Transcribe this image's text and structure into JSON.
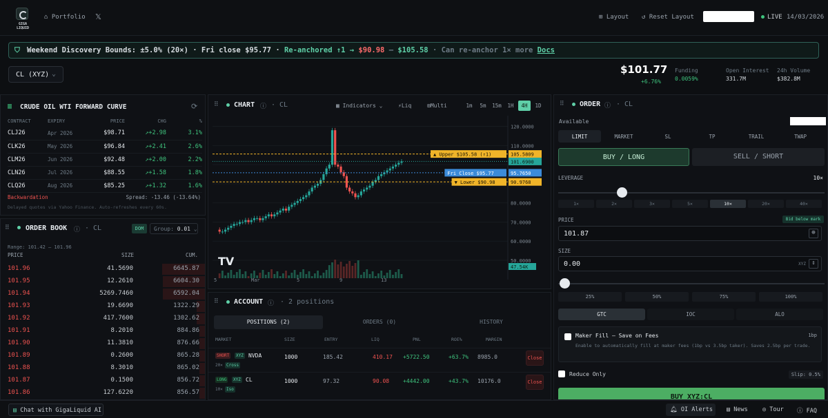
{
  "topbar": {
    "logo_text": "GIGA",
    "logo_sub": "LIQUID",
    "portfolio": "Portfolio",
    "x_icon": "x-icon",
    "layout": "Layout",
    "reset_layout": "Reset Layout",
    "live": "LIVE",
    "date": "14/03/2026"
  },
  "banner": {
    "part1": "Weekend Discovery Bounds: ±5.0% (20×) · Fri close $95.77 · ",
    "part2": "Re-anchored ↑1 → ",
    "low": "$90.98",
    "dash": " – ",
    "high": "$105.58",
    "part3": " · Can re-anchor 1× more ",
    "docs": "Docs"
  },
  "market": {
    "symbol": "CL (XYZ)",
    "price": "$101.77",
    "change": "+6.76%",
    "funding_label": "Funding",
    "funding": "0.0059%",
    "oi_label": "Open Interest",
    "oi": "331.7M",
    "vol_label": "24h Volume",
    "vol": "$382.8M"
  },
  "curve": {
    "title": "CRUDE OIL WTI FORWARD CURVE",
    "headers": [
      "CONTRACT",
      "EXPIRY",
      "PRICE",
      "CHG",
      "%"
    ],
    "rows": [
      [
        "CLJ26",
        "Apr 2026",
        "$98.71",
        "↗+2.98",
        "3.1%"
      ],
      [
        "CLK26",
        "May 2026",
        "$96.84",
        "↗+2.41",
        "2.6%"
      ],
      [
        "CLM26",
        "Jun 2026",
        "$92.48",
        "↗+2.00",
        "2.2%"
      ],
      [
        "CLN26",
        "Jul 2026",
        "$88.55",
        "↗+1.58",
        "1.8%"
      ],
      [
        "CLQ26",
        "Aug 2026",
        "$85.25",
        "↗+1.32",
        "1.6%"
      ]
    ],
    "structure": "Backwardation",
    "spread": "Spread: -13.46 (-13.64%)",
    "note": "Delayed quotes via Yahoo Finance. Auto-refreshes every 60s."
  },
  "orderbook": {
    "title": "ORDER BOOK",
    "sym": "· CL",
    "dom": "DOM",
    "group_label": "Group:",
    "group": "0.01",
    "range": "Range: 101.42 – 101.96",
    "headers": [
      "PRICE",
      "SIZE",
      "CUM."
    ],
    "rows": [
      [
        "101.96",
        "41.5690",
        "6645.87"
      ],
      [
        "101.95",
        "12.2610",
        "6604.30"
      ],
      [
        "101.94",
        "5269.7460",
        "6592.04"
      ],
      [
        "101.93",
        "19.6690",
        "1322.29"
      ],
      [
        "101.92",
        "417.7600",
        "1302.62"
      ],
      [
        "101.91",
        "8.2010",
        "884.86"
      ],
      [
        "101.90",
        "11.3810",
        "876.66"
      ],
      [
        "101.89",
        "0.2600",
        "865.28"
      ],
      [
        "101.88",
        "8.3010",
        "865.02"
      ],
      [
        "101.87",
        "0.1500",
        "856.72"
      ],
      [
        "101.86",
        "127.6220",
        "856.57"
      ],
      [
        "101.85",
        "19.1150",
        "728.95"
      ]
    ],
    "depth": [
      1.0,
      0.99,
      0.99,
      0.2,
      0.2,
      0.13,
      0.13,
      0.13,
      0.13,
      0.13,
      0.13,
      0.11
    ]
  },
  "chart": {
    "title": "CHART",
    "sym": "· CL",
    "indicators": "Indicators",
    "liq": "Liq",
    "multi": "Multi",
    "timeframes": [
      "1m",
      "5m",
      "15m",
      "1H",
      "4H",
      "1D"
    ],
    "active_tf": "4H",
    "upper_label": "▲ Upper $105.58 (↑1)",
    "upper_val": "105.5809",
    "last_val": "101.6900",
    "fri_label": "Fri Close $95.77",
    "fri_val": "95.7650",
    "lower_label": "▼ Lower $90.98",
    "lower_val": "90.9768",
    "vol_val": "47.54K",
    "watermark": "TV",
    "colors": {
      "up": "#26a69a",
      "down": "#ef5350",
      "upper": "#f0b429",
      "fri": "#3c8bd9"
    }
  },
  "chart_data": {
    "type": "line",
    "x_ticks": [
      "5",
      "Mar",
      "5",
      "9",
      "13"
    ],
    "y_ticks": [
      "120.0000",
      "110.0000",
      "80.0000",
      "70.0000",
      "60.0000",
      "50.0000"
    ],
    "ylim": [
      50,
      122
    ],
    "series": [
      {
        "values": [
          66,
          65,
          65,
          66,
          67,
          68,
          69,
          69,
          70,
          70,
          71,
          70,
          71,
          72,
          72,
          71,
          72,
          73,
          74,
          73,
          74,
          75,
          76,
          77,
          76,
          78,
          79,
          80,
          81,
          82,
          83,
          84,
          86,
          88,
          89,
          90,
          92,
          95,
          98,
          100,
          118,
          100,
          99,
          96,
          94,
          88,
          86,
          85,
          83,
          84,
          86,
          87,
          88,
          89,
          91,
          92,
          94,
          95,
          96,
          97,
          98,
          99,
          100,
          101,
          101.7
        ]
      }
    ]
  },
  "account": {
    "title": "ACCOUNT",
    "positions_count": "· 2 positions",
    "tabs": [
      "POSITIONS (2)",
      "ORDERS (0)",
      "HISTORY"
    ],
    "headers": [
      "MARKET",
      "SIZE",
      "ENTRY",
      "LIQ",
      "PNL",
      "ROE%",
      "MARGIN"
    ],
    "rows": [
      {
        "side": "SHORT",
        "dex": "XYZ",
        "sym": "NVDA",
        "lev": "20×",
        "mode": "Cross",
        "size": "1000",
        "entry": "185.42",
        "liq": "410.17",
        "pnl": "+5722.50",
        "roe": "+63.7%",
        "margin": "8985.0",
        "close": "Close"
      },
      {
        "side": "LONG",
        "dex": "XYZ",
        "sym": "CL",
        "lev": "10×",
        "mode": "Iso",
        "size": "1000",
        "entry": "97.32",
        "liq": "90.08",
        "pnl": "+4442.00",
        "roe": "+43.7%",
        "margin": "10176.0",
        "close": "Close"
      }
    ]
  },
  "order": {
    "title": "ORDER",
    "sym": "· CL",
    "available": "Available",
    "types": [
      "LIMIT",
      "MARKET",
      "SL",
      "TP",
      "TRAIL",
      "TWAP"
    ],
    "buy": "BUY / LONG",
    "sell": "SELL / SHORT",
    "leverage_label": "LEVERAGE",
    "leverage": "10×",
    "leverage_options": [
      "1×",
      "2×",
      "3×",
      "5×",
      "10×",
      "20×",
      "40×"
    ],
    "price_label": "PRICE",
    "bid_below": "Bid below mark",
    "price": "101.87",
    "size_label": "SIZE",
    "size": "0.00",
    "size_unit": "XYZ",
    "percents": [
      "25%",
      "50%",
      "75%",
      "100%"
    ],
    "tif": [
      "GTC",
      "IOC",
      "ALO"
    ],
    "maker_title": "Maker Fill — Save on Fees",
    "maker_bps": "1bp",
    "maker_desc": "Enable to automatically fill at maker fees (1bp vs 3.5bp taker). Saves 2.5bp per trade.",
    "reduce_only": "Reduce Only",
    "slip": "Slip: 0.5%",
    "submit": "BUY XYZ:CL"
  },
  "footer": {
    "chat": "Chat with GigaLiquid AI",
    "alerts": "OI Alerts",
    "news": "News",
    "tour": "Tour",
    "faq": "FAQ"
  }
}
